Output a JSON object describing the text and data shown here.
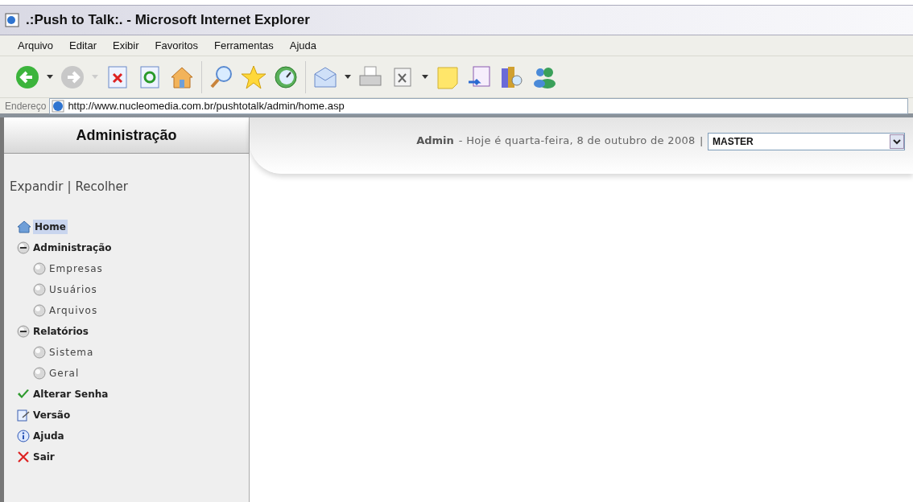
{
  "window": {
    "title": ".:Push to Talk:. - Microsoft Internet Explorer"
  },
  "menu": [
    "Arquivo",
    "Editar",
    "Exibir",
    "Favoritos",
    "Ferramentas",
    "Ajuda"
  ],
  "address_bar": {
    "label": "Endereço",
    "value": "http://www.nucleomedia.com.br/pushtotalk/admin/home.asp"
  },
  "sidebar": {
    "title": "Administração",
    "expand": "Expandir",
    "separator": "|",
    "collapse": "Recolher",
    "items": [
      {
        "label": "Home",
        "kind": "home",
        "selected": true
      },
      {
        "label": "Administração",
        "kind": "group",
        "selected": false,
        "expanded": true,
        "children": [
          {
            "label": "Empresas",
            "kind": "leaf",
            "selected": false
          },
          {
            "label": "Usuários",
            "kind": "leaf",
            "selected": false
          },
          {
            "label": "Arquivos",
            "kind": "leaf",
            "selected": false
          }
        ]
      },
      {
        "label": "Relatórios",
        "kind": "group",
        "selected": false,
        "expanded": true,
        "children": [
          {
            "label": "Sistema",
            "kind": "leaf",
            "selected": false
          },
          {
            "label": "Geral",
            "kind": "leaf",
            "selected": false
          }
        ]
      },
      {
        "label": "Alterar Senha",
        "kind": "check",
        "selected": false
      },
      {
        "label": "Versão",
        "kind": "version",
        "selected": false
      },
      {
        "label": "Ajuda",
        "kind": "help",
        "selected": false
      },
      {
        "label": "Sair",
        "kind": "exit",
        "selected": false
      }
    ]
  },
  "header": {
    "user": "Admin",
    "date": "- Hoje é quarta-feira, 8 de outubro de 2008",
    "separator": "|",
    "select": "MASTER"
  }
}
